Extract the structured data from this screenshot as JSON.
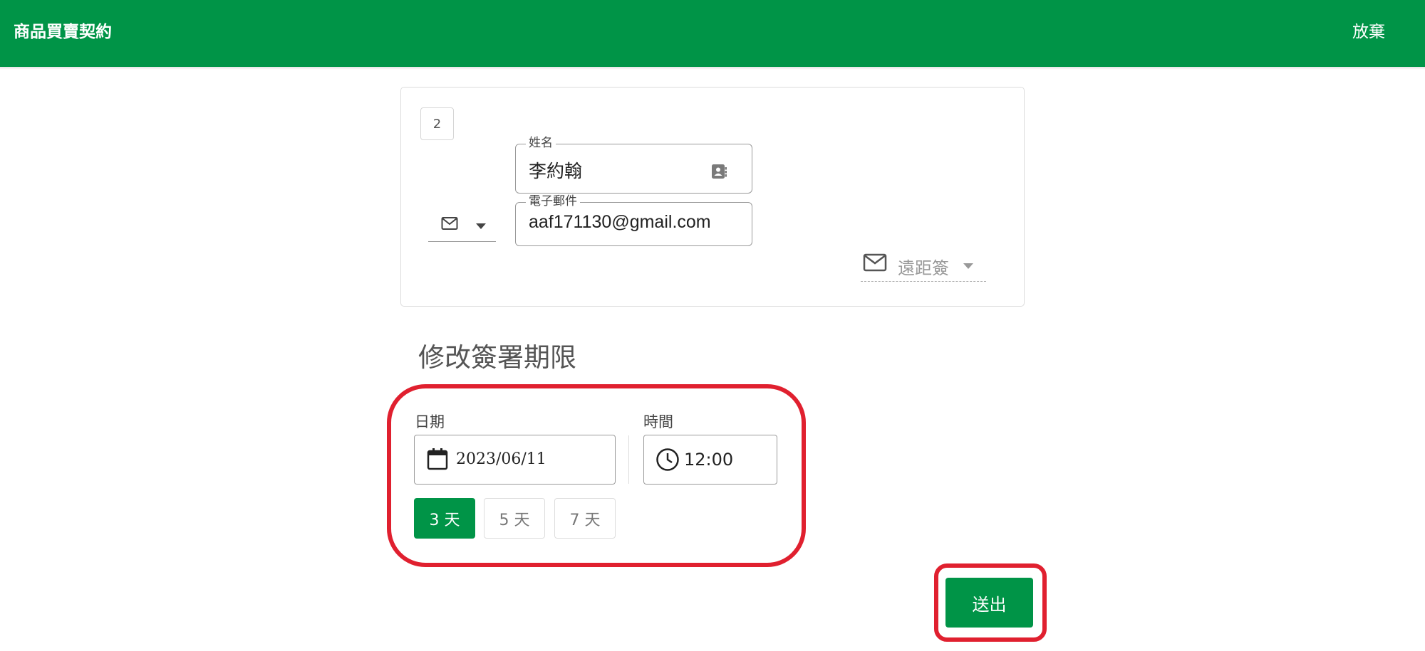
{
  "header": {
    "title": "商品買賣契約",
    "abandon_label": "放棄"
  },
  "signer": {
    "order": "2",
    "name_label": "姓名",
    "name_value": "李約翰",
    "email_label": "電子郵件",
    "email_value": "aaf171130@gmail.com",
    "delivery_method_icon": "mail-icon",
    "sign_mode_label": "遠距簽"
  },
  "deadline": {
    "title": "修改簽署期限",
    "date_label": "日期",
    "date_value": "2023/06/11",
    "time_label": "時間",
    "time_value": "12:00",
    "quick_options": [
      "3 天",
      "5 天",
      "7 天"
    ],
    "selected_option": "3 天"
  },
  "actions": {
    "submit_label": "送出"
  },
  "colors": {
    "brand": "#009447",
    "highlight": "#e0202f"
  }
}
